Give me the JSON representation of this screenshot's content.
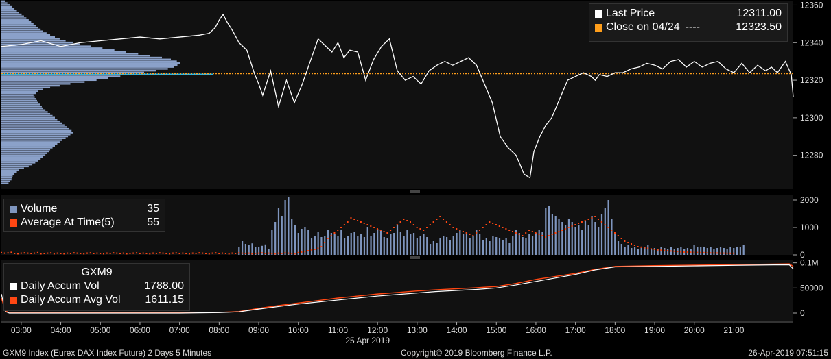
{
  "colors": {
    "price_line": "#ffffff",
    "close_line": "#ff9e1b",
    "volume_bar": "#7f96bf",
    "avg_dot": "#ff4713",
    "accum_vol": "#ffffff",
    "accum_avg": "#ff4713",
    "profile_bar": "#8ba1c9",
    "profile_highlight": "#25b6e8",
    "panel_bg": "#111111",
    "axis_text": "#dddddd"
  },
  "legend_price": {
    "last_label": "Last Price",
    "last_value": "12311.00",
    "close_label": "Close on 04/24",
    "close_dashes": "----",
    "close_value": "12323.50"
  },
  "legend_volume": {
    "vol_label": "Volume",
    "vol_value": "35",
    "avg_label": "Average At Time(5)",
    "avg_value": "55"
  },
  "legend_accum": {
    "ticker": "GXM9",
    "vol_label": "Daily Accum Vol",
    "vol_value": "1788.00",
    "avg_label": "Daily Accum Avg Vol",
    "avg_value": "1611.15"
  },
  "footer": {
    "left": "GXM9 Index (Eurex DAX Index Future) 2 Days 5 Minutes",
    "center": "Copyright© 2019 Bloomberg Finance L.P.",
    "right": "26-Apr-2019 07:51:15"
  },
  "chart_data": [
    {
      "type": "line",
      "panel": "price",
      "ylim": [
        12262,
        12362
      ],
      "yticks": [
        12280,
        12300,
        12320,
        12340,
        12360
      ],
      "xlim": [
        2.5,
        22.5
      ],
      "reference_line": {
        "name": "Close on 04/24",
        "value": 12323.5,
        "style": "dotted"
      },
      "series": [
        {
          "name": "Last Price",
          "x": [
            2.5,
            3.0,
            3.5,
            4.0,
            4.5,
            5.0,
            5.5,
            6.0,
            6.5,
            7.0,
            7.5,
            7.75,
            7.9,
            8.0,
            8.1,
            8.2,
            8.35,
            8.5,
            8.7,
            8.9,
            9.0,
            9.1,
            9.3,
            9.5,
            9.7,
            9.9,
            10.1,
            10.3,
            10.5,
            10.7,
            10.85,
            11.0,
            11.15,
            11.3,
            11.5,
            11.7,
            11.9,
            12.1,
            12.3,
            12.5,
            12.7,
            12.9,
            13.1,
            13.3,
            13.5,
            13.7,
            13.9,
            14.1,
            14.3,
            14.5,
            14.7,
            14.9,
            15.1,
            15.3,
            15.5,
            15.7,
            15.85,
            15.95,
            16.1,
            16.25,
            16.4,
            16.6,
            16.8,
            17.0,
            17.2,
            17.4,
            17.5,
            17.6,
            17.8,
            18.0,
            18.2,
            18.4,
            18.6,
            18.8,
            19.0,
            19.2,
            19.4,
            19.6,
            19.8,
            20.0,
            20.2,
            20.4,
            20.6,
            20.8,
            21.0,
            21.2,
            21.4,
            21.6,
            21.8,
            21.95,
            22.1,
            22.3,
            22.45,
            22.5
          ],
          "y": [
            12338,
            12339,
            12341,
            12338,
            12340,
            12341,
            12342,
            12343,
            12342,
            12343,
            12344,
            12345,
            12348,
            12352,
            12355,
            12351,
            12346,
            12340,
            12336,
            12323,
            12318,
            12312,
            12325,
            12306,
            12320,
            12308,
            12318,
            12330,
            12342,
            12338,
            12335,
            12340,
            12332,
            12336,
            12335,
            12320,
            12331,
            12338,
            12342,
            12325,
            12320,
            12322,
            12318,
            12325,
            12328,
            12330,
            12328,
            12330,
            12332,
            12328,
            12318,
            12308,
            12290,
            12284,
            12280,
            12270,
            12268,
            12282,
            12290,
            12296,
            12300,
            12310,
            12320,
            12322,
            12324,
            12322,
            12320,
            12323,
            12322,
            12324,
            12324,
            12326,
            12327,
            12329,
            12328,
            12326,
            12330,
            12331,
            12327,
            12330,
            12327,
            12329,
            12330,
            12326,
            12324,
            12329,
            12324,
            12328,
            12325,
            12327,
            12324,
            12330,
            12323,
            12311
          ]
        }
      ]
    },
    {
      "type": "bar",
      "panel": "volume_profile",
      "orientation": "horizontal",
      "y_step": 1,
      "y_start": 12265,
      "highlight_level": 12323,
      "values": [
        120,
        150,
        170,
        180,
        190,
        220,
        260,
        300,
        380,
        460,
        520,
        570,
        620,
        660,
        700,
        740,
        770,
        800,
        820,
        860,
        900,
        940,
        980,
        1020,
        1080,
        1120,
        1160,
        1200,
        1180,
        1140,
        1100,
        1060,
        1020,
        980,
        940,
        900,
        860,
        820,
        780,
        740,
        700,
        680,
        650,
        620,
        600,
        580,
        560,
        540,
        580,
        620,
        700,
        820,
        980,
        1160,
        1400,
        1600,
        1800,
        2000,
        2200,
        2400,
        2600,
        2800,
        2900,
        2960,
        3000,
        2950,
        2850,
        2700,
        2500,
        2300,
        2100,
        1900,
        1700,
        1500,
        1320,
        1200,
        1080,
        980,
        900,
        820,
        760,
        700,
        660,
        620,
        580,
        540,
        500,
        460,
        420,
        380,
        340,
        300,
        260,
        220,
        180,
        140,
        100,
        60
      ]
    },
    {
      "type": "bar",
      "panel": "volume",
      "ylim": [
        0,
        2200
      ],
      "yticks": [
        0,
        1000,
        2000
      ],
      "xlim": [
        2.5,
        22.5
      ],
      "series": [
        {
          "name": "Volume",
          "x_start": 8.5,
          "x_step": 0.0833,
          "values": [
            300,
            500,
            400,
            350,
            420,
            300,
            280,
            330,
            380,
            200,
            900,
            1200,
            1700,
            1400,
            2000,
            2100,
            1300,
            1100,
            800,
            950,
            1000,
            900,
            600,
            700,
            850,
            650,
            700,
            900,
            800,
            750,
            700,
            900,
            600,
            700,
            800,
            850,
            700,
            750,
            650,
            1000,
            700,
            800,
            950,
            900,
            650,
            600,
            750,
            800,
            1100,
            850,
            700,
            900,
            750,
            800,
            600,
            700,
            750,
            650,
            400,
            500,
            450,
            600,
            700,
            650,
            550,
            700,
            800,
            900,
            750,
            850,
            600,
            700,
            900,
            750,
            550,
            600,
            500,
            700,
            650,
            600,
            550,
            600,
            450,
            700,
            900,
            800,
            650,
            600,
            750,
            700,
            800,
            900,
            850,
            1700,
            1800,
            1500,
            1400,
            1300,
            1200,
            1100,
            1300,
            1200,
            1000,
            1100,
            900,
            1250,
            1100,
            1400,
            1200,
            1000,
            1500,
            1700,
            2000,
            1300,
            800,
            500,
            400,
            300,
            350,
            250,
            300,
            200,
            250,
            300,
            350,
            200,
            250,
            200,
            300,
            250,
            200,
            300,
            200,
            250,
            300,
            200,
            250,
            200,
            350,
            300,
            280,
            300,
            250,
            300,
            200,
            250,
            300,
            250,
            200,
            300,
            250,
            280,
            300,
            350
          ]
        },
        {
          "name": "Average At Time(5)",
          "x_start": 2.5,
          "x_step": 0.0833,
          "values": [
            80,
            60,
            70,
            90,
            50,
            40,
            60,
            70,
            60,
            50,
            60,
            80,
            40,
            50,
            60,
            70,
            40,
            60,
            50,
            40,
            60,
            50,
            70,
            60,
            50,
            40,
            60,
            70,
            50,
            60,
            50,
            40,
            60,
            50,
            70,
            60,
            50,
            60,
            40,
            50,
            60,
            70,
            50,
            60,
            50,
            40,
            60,
            50,
            70,
            60,
            50,
            40,
            60,
            70,
            50,
            60,
            50,
            40,
            60,
            50,
            70,
            60,
            50,
            40,
            60,
            70,
            50,
            60,
            50,
            40,
            60,
            50,
            70,
            60,
            50,
            60,
            40,
            50,
            60,
            70,
            50,
            60,
            50,
            40,
            60,
            50,
            70,
            60,
            50,
            40,
            80,
            100,
            120,
            150,
            180,
            200,
            240,
            300,
            450,
            600,
            700,
            800,
            900,
            1000,
            1100,
            1200,
            1350,
            1300,
            1250,
            1200,
            1150,
            1100,
            1050,
            1000,
            950,
            900,
            850,
            800,
            900,
            1000,
            1100,
            1200,
            1300,
            1250,
            1200,
            1100,
            1000,
            950,
            900,
            1000,
            1100,
            1200,
            1300,
            1400,
            1300,
            1200,
            1100,
            1000,
            950,
            900,
            850,
            800,
            750,
            700,
            800,
            900,
            1000,
            1100,
            1200,
            1150,
            1100,
            1050,
            1000,
            950,
            900,
            850,
            800,
            750,
            700,
            800,
            900,
            850,
            800,
            750,
            700,
            650,
            700,
            750,
            800,
            850,
            900,
            950,
            1000,
            1050,
            1100,
            1150,
            1200,
            1250,
            1300,
            1350,
            1400,
            1300,
            1200,
            1100,
            1000,
            900,
            800,
            700,
            600,
            500,
            450,
            400,
            350,
            300,
            280,
            260,
            240,
            220,
            200,
            180,
            170,
            160,
            150,
            140,
            130,
            120,
            110,
            100,
            100,
            95,
            90,
            85,
            80,
            80,
            75,
            70,
            70,
            65,
            60,
            60,
            55,
            55,
            55
          ]
        }
      ]
    },
    {
      "type": "line",
      "panel": "accumulated",
      "ylim": [
        -15000,
        105000
      ],
      "yticks": [
        0,
        50000,
        100000
      ],
      "yticklabels": [
        "0",
        "50000",
        "0.1M"
      ],
      "xlim": [
        2.5,
        22.5
      ],
      "xticks": [
        3,
        4,
        5,
        6,
        7,
        8,
        9,
        10,
        11,
        12,
        13,
        14,
        15,
        16,
        17,
        18,
        19,
        20,
        21
      ],
      "xticklabels": [
        "03:00",
        "04:00",
        "05:00",
        "06:00",
        "07:00",
        "08:00",
        "09:00",
        "10:00",
        "11:00",
        "12:00",
        "13:00",
        "14:00",
        "15:00",
        "16:00",
        "17:00",
        "18:00",
        "19:00",
        "20:00",
        "21:00"
      ],
      "date_label": "25 Apr 2019",
      "series": [
        {
          "name": "Daily Accum Vol",
          "x": [
            2.5,
            2.6,
            2.7,
            3.0,
            4.0,
            5.0,
            6.0,
            7.0,
            8.0,
            8.5,
            9.0,
            9.5,
            10.0,
            10.5,
            11.0,
            11.5,
            12.0,
            12.5,
            13.0,
            13.5,
            14.0,
            14.5,
            15.0,
            15.5,
            16.0,
            16.5,
            17.0,
            17.5,
            18.0,
            19.0,
            20.0,
            21.0,
            22.0,
            22.4,
            22.5
          ],
          "y": [
            38000,
            3000,
            0,
            0,
            0,
            0,
            0,
            0,
            1000,
            2500,
            8000,
            13000,
            18000,
            22000,
            26000,
            30000,
            34000,
            37000,
            40000,
            43000,
            45000,
            47000,
            50000,
            56000,
            63000,
            70000,
            77000,
            86000,
            92000,
            93000,
            94000,
            95000,
            96000,
            96000,
            88000
          ]
        },
        {
          "name": "Daily Accum Avg Vol",
          "x": [
            2.5,
            2.6,
            2.7,
            3.0,
            4.0,
            5.0,
            6.0,
            7.0,
            8.0,
            8.5,
            9.0,
            9.5,
            10.0,
            10.5,
            11.0,
            11.5,
            12.0,
            12.5,
            13.0,
            13.5,
            14.0,
            14.5,
            15.0,
            15.5,
            16.0,
            16.5,
            17.0,
            17.5,
            18.0,
            19.0,
            20.0,
            21.0,
            22.0,
            22.4,
            22.5
          ],
          "y": [
            30000,
            5000,
            500,
            500,
            600,
            700,
            800,
            900,
            1500,
            3000,
            9500,
            15000,
            20000,
            25000,
            30000,
            34000,
            38000,
            41000,
            44000,
            46500,
            48500,
            50500,
            53000,
            59000,
            67000,
            73000,
            79000,
            87000,
            93000,
            94500,
            95500,
            96500,
            97500,
            98000,
            93000
          ]
        }
      ]
    }
  ]
}
